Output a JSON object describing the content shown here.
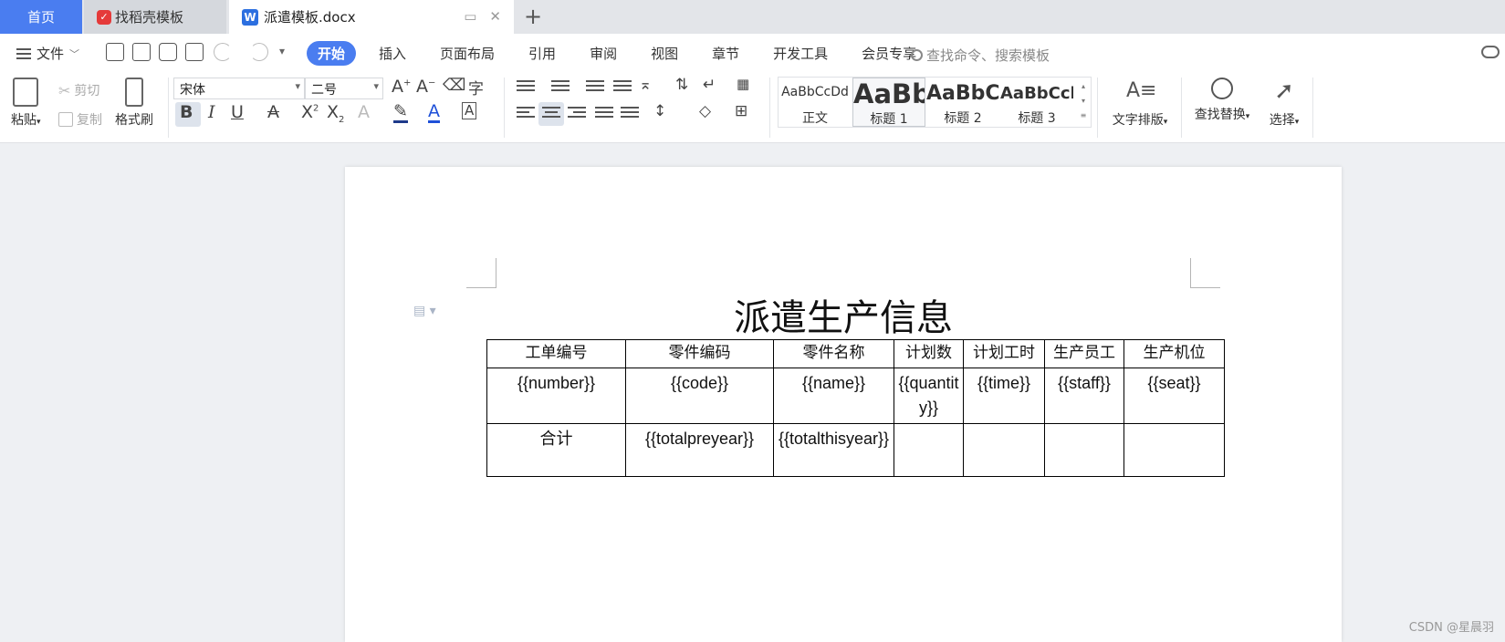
{
  "tabs": {
    "home": "首页",
    "template_store": "找稻壳模板",
    "document": "派遣模板.docx"
  },
  "menu": {
    "file": "文件",
    "tabs": [
      "开始",
      "插入",
      "页面布局",
      "引用",
      "审阅",
      "视图",
      "章节",
      "开发工具",
      "会员专享"
    ],
    "active_tab": "开始",
    "search_placeholder": "查找命令、搜索模板"
  },
  "ribbon": {
    "paste": "粘贴",
    "cut": "剪切",
    "copy": "复制",
    "format_painter": "格式刷",
    "font_name": "宋体",
    "font_size": "二号",
    "styles": [
      {
        "sample": "AaBbCcDd",
        "name": "正文"
      },
      {
        "sample": "AaBb",
        "name": "标题 1"
      },
      {
        "sample": "AaBbC",
        "name": "标题 2"
      },
      {
        "sample": "AaBbCcl",
        "name": "标题 3"
      }
    ],
    "text_layout": "文字排版",
    "find_replace": "查找替换",
    "select": "选择"
  },
  "document": {
    "title": "派遣生产信息",
    "table": {
      "header": [
        "工单编号",
        "零件编码",
        "零件名称",
        "计划数",
        "计划工时",
        "生产员工",
        "生产机位"
      ],
      "row1": [
        "{{number}}",
        "{{code}}",
        "{{name}}",
        "{{quantity}}",
        "{{time}}",
        "{{staff}}",
        "{{seat}}"
      ],
      "row2": [
        "合计",
        "{{totalpreyear}}",
        "{{totalthisyear}}",
        "",
        "",
        "",
        ""
      ]
    }
  },
  "watermark": "CSDN @星晨羽",
  "colors": {
    "accent": "#4a7df0",
    "page": "#ffffff",
    "canvas": "#eef0f3"
  }
}
